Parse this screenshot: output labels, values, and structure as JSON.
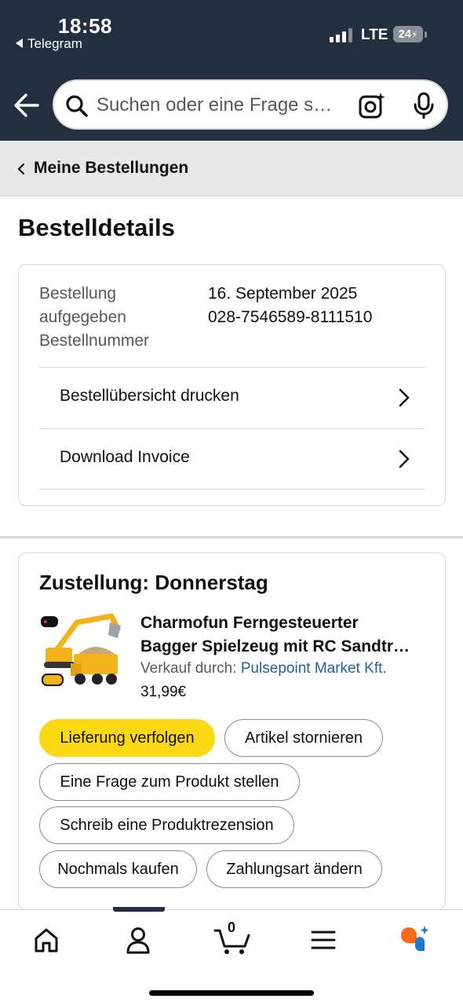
{
  "status_bar": {
    "time": "18:58",
    "back_app": "Telegram",
    "network": "LTE",
    "battery": "24"
  },
  "search": {
    "placeholder": "Suchen oder eine Frage s…"
  },
  "breadcrumb": {
    "label": "Meine Bestellungen"
  },
  "page": {
    "title": "Bestelldetails"
  },
  "order_info": {
    "label_lines": [
      "Bestellung",
      "aufgegeben",
      "Bestellnummer"
    ],
    "order_date": "16. September 2025",
    "order_number": "028-7546589-8111510",
    "links": [
      {
        "label": "Bestellübersicht drucken"
      },
      {
        "label": "Download Invoice"
      }
    ]
  },
  "shipment": {
    "heading": "Zustellung: Donnerstag",
    "product": {
      "title_line1": "Charmofun Ferngesteuerter",
      "title_line2": "Bagger Spielzeug mit RC Sandtr…",
      "seller_prefix": "Verkauf durch:",
      "seller_name": "Pulsepoint Market Kft.",
      "price": "31,99€"
    },
    "actions": [
      {
        "label": "Lieferung verfolgen",
        "primary": true
      },
      {
        "label": "Artikel stornieren"
      },
      {
        "label": "Eine Frage zum Produkt stellen"
      },
      {
        "label": "Schreib eine Produktrezension"
      },
      {
        "label": "Nochmals kaufen"
      },
      {
        "label": "Zahlungsart ändern"
      }
    ]
  },
  "bottom_nav": {
    "items": [
      {
        "icon": "home-icon"
      },
      {
        "icon": "account-icon"
      },
      {
        "icon": "cart-icon",
        "count": "0"
      },
      {
        "icon": "menu-icon"
      },
      {
        "icon": "rufus-assistant-icon"
      }
    ]
  },
  "colors": {
    "header_bg": "#232f3e",
    "primary_button": "#ffd814",
    "link": "#2162a1",
    "assistant_orange": "#ff6a1a",
    "assistant_blue": "#1a7bd7"
  }
}
